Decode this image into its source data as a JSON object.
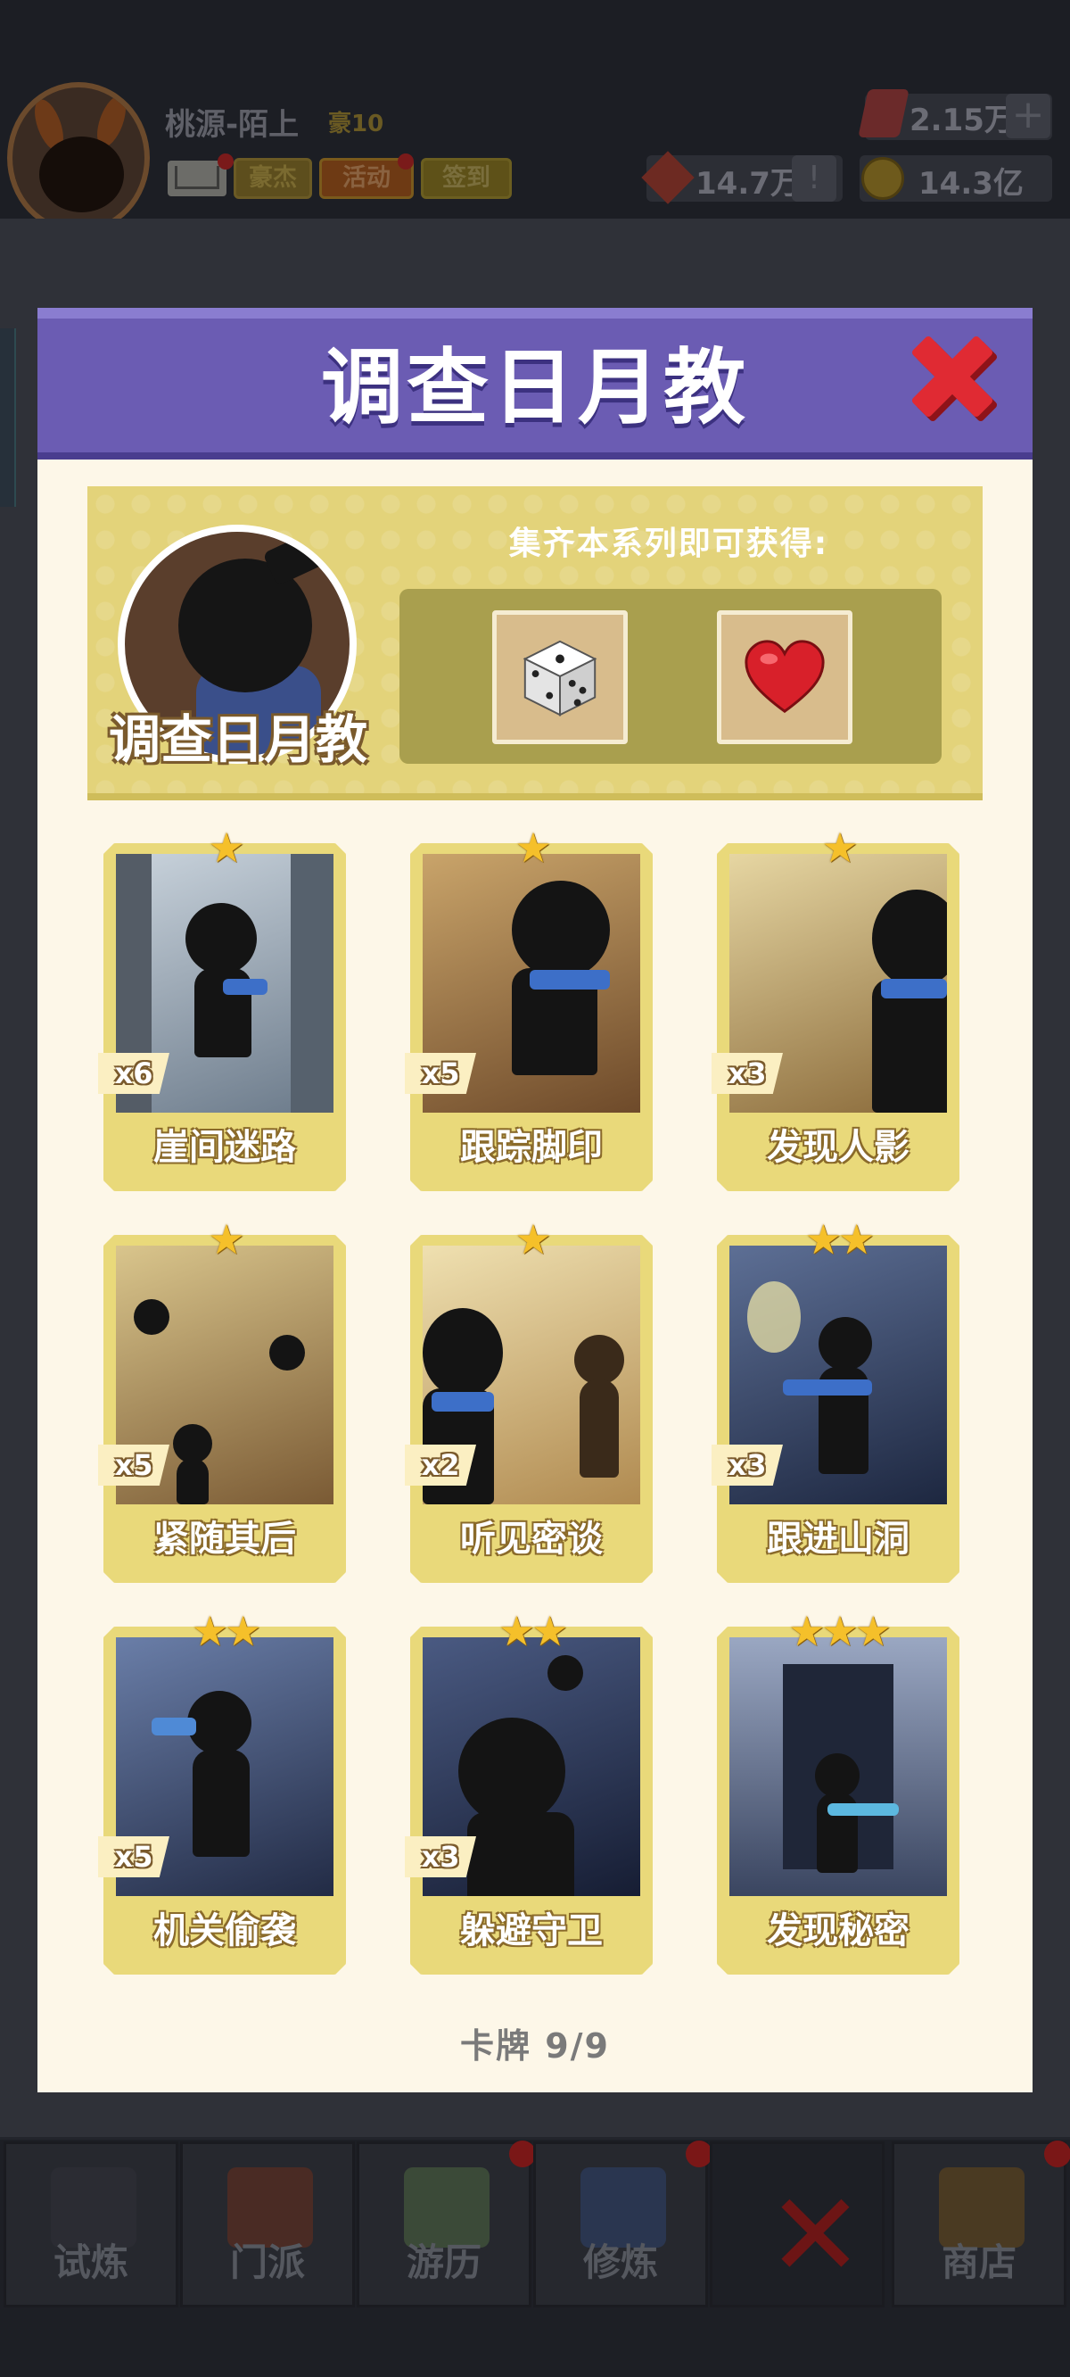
{
  "player": {
    "name": "桃源-陌上",
    "rank": "豪10",
    "buttons": {
      "haojie": "豪杰",
      "huodong": "活动",
      "qiandao": "签到"
    }
  },
  "resources": {
    "gems": "2.15万",
    "gems_plus": "+",
    "red_tokens": "14.7万",
    "red_tokens_btn": "!",
    "gold": "14.3亿"
  },
  "modal": {
    "title": "调查日月教",
    "series_name": "调查日月教",
    "reward_caption": "集齐本系列即可获得:",
    "rewards": [
      {
        "icon": "dice-icon"
      },
      {
        "icon": "heart-icon"
      }
    ],
    "cards": [
      {
        "name": "崖间迷路",
        "count": "x6",
        "stars": "★"
      },
      {
        "name": "跟踪脚印",
        "count": "x5",
        "stars": "★"
      },
      {
        "name": "发现人影",
        "count": "x3",
        "stars": "★"
      },
      {
        "name": "紧随其后",
        "count": "x5",
        "stars": "★"
      },
      {
        "name": "听见密谈",
        "count": "x2",
        "stars": "★"
      },
      {
        "name": "跟进山洞",
        "count": "x3",
        "stars": "★★"
      },
      {
        "name": "机关偷袭",
        "count": "x5",
        "stars": "★★"
      },
      {
        "name": "躲避守卫",
        "count": "x3",
        "stars": "★★"
      },
      {
        "name": "发现秘密",
        "count": "",
        "stars": "★★★"
      }
    ],
    "counter": "卡牌  9/9"
  },
  "bottom_nav": [
    {
      "label": "试炼",
      "badge": false
    },
    {
      "label": "门派",
      "badge": false
    },
    {
      "label": "游历",
      "badge": true
    },
    {
      "label": "修炼",
      "badge": true
    },
    {
      "label": "",
      "badge": false
    },
    {
      "label": "商店",
      "badge": true
    }
  ],
  "colors": {
    "header_purple": "#6b5cb3",
    "banner_yellow": "#e3d37a",
    "card_frame": "#e9d97a",
    "close_red": "#d9232d",
    "star_gold": "#f5c02a"
  }
}
